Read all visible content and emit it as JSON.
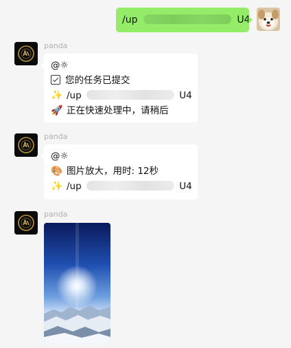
{
  "outgoing": {
    "prefix": "/up",
    "suffix": "U4",
    "avatar_icon": "dog-avatar-icon"
  },
  "messages": [
    {
      "sender": "panda",
      "mention": "@",
      "lines": [
        {
          "icon": "checkbox-icon",
          "text": "您的任务已提交"
        },
        {
          "icon": "sparkles-icon",
          "glyph": "✨",
          "prefix": "/up",
          "suffix": "U4"
        },
        {
          "icon": "rocket-icon",
          "glyph": "🚀",
          "text": "正在快速处理中，请稍后"
        }
      ]
    },
    {
      "sender": "panda",
      "mention": "@",
      "lines": [
        {
          "icon": "palette-icon",
          "glyph": "🎨",
          "text": "图片放大，用时: 12秒"
        },
        {
          "icon": "sparkles-icon",
          "glyph": "✨",
          "prefix": "/up",
          "suffix": "U4"
        }
      ]
    },
    {
      "sender": "panda",
      "image_icon": "upscaled-sky-image"
    }
  ],
  "colors": {
    "outgoing_bubble": "#95ec69",
    "incoming_bubble": "#ffffff",
    "background": "#f5f5f5",
    "sender_name": "#b0b0b0"
  }
}
